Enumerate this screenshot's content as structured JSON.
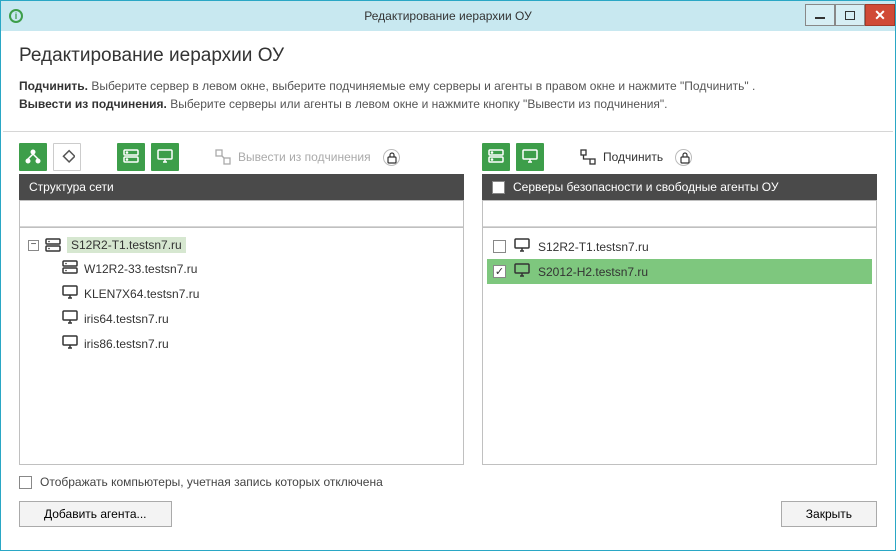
{
  "window": {
    "title": "Редактирование иерархии ОУ"
  },
  "header": {
    "title": "Редактирование иерархии ОУ",
    "line1_bold": "Подчинить.",
    "line1_rest": " Выберите сервер в левом окне, выберите подчиняемые ему серверы и агенты в правом окне и нажмите \"Подчинить\" .",
    "line2_bold": "Вывести из подчинения.",
    "line2_rest": " Выберите серверы или агенты в левом окне и нажмите кнопку \"Вывести из подчинения\"."
  },
  "left": {
    "detach_label": "Вывести из подчинения",
    "column_header": "Структура сети",
    "root": {
      "label": "S12R2-T1.testsn7.ru",
      "icon": "server"
    },
    "children": [
      {
        "label": "W12R2-33.testsn7.ru",
        "icon": "server"
      },
      {
        "label": "KLEN7X64.testsn7.ru",
        "icon": "monitor"
      },
      {
        "label": "iris64.testsn7.ru",
        "icon": "monitor"
      },
      {
        "label": "iris86.testsn7.ru",
        "icon": "monitor"
      }
    ]
  },
  "right": {
    "attach_label": "Подчинить",
    "column_header": "Серверы безопасности и свободные агенты ОУ",
    "items": [
      {
        "label": "S12R2-T1.testsn7.ru",
        "checked": false,
        "selected": false
      },
      {
        "label": "S2012-H2.testsn7.ru",
        "checked": true,
        "selected": true
      }
    ]
  },
  "bottom": {
    "show_disabled_label": "Отображать компьютеры, учетная запись которых отключена",
    "add_agent_label": "Добавить агента...",
    "close_label": "Закрыть"
  },
  "colors": {
    "accent": "#3d9e4a",
    "titlebar": "#c8e8f0",
    "selected_right": "#7ec77e",
    "selected_left": "#d6e7d0"
  }
}
